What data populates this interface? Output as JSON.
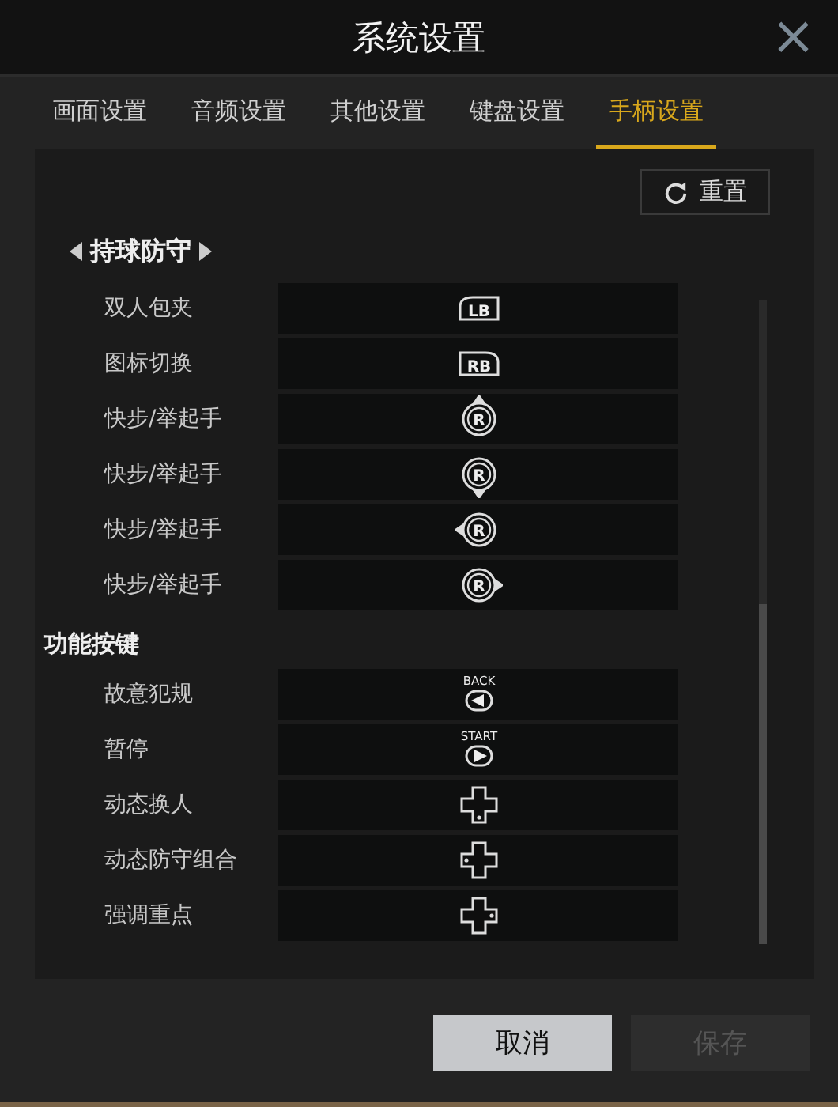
{
  "window": {
    "title": "系统设置",
    "close": "×"
  },
  "tabs": [
    {
      "label": "画面设置",
      "selected": false
    },
    {
      "label": "音频设置",
      "selected": false
    },
    {
      "label": "其他设置",
      "selected": false
    },
    {
      "label": "键盘设置",
      "selected": false
    },
    {
      "label": "手柄设置",
      "selected": true
    }
  ],
  "reset_button": {
    "label": "重置"
  },
  "sections": [
    {
      "title": "持球防守",
      "kind": "switcher",
      "rows": [
        {
          "label": "双人包夹",
          "binding": {
            "kind": "bumper-left",
            "text": "LB"
          }
        },
        {
          "label": "图标切换",
          "binding": {
            "kind": "bumper-right",
            "text": "RB"
          }
        },
        {
          "label": "快步/举起手",
          "binding": {
            "kind": "stick-up",
            "text": "R"
          }
        },
        {
          "label": "快步/举起手",
          "binding": {
            "kind": "stick-down",
            "text": "R"
          }
        },
        {
          "label": "快步/举起手",
          "binding": {
            "kind": "stick-left",
            "text": "R"
          }
        },
        {
          "label": "快步/举起手",
          "binding": {
            "kind": "stick-right",
            "text": "R"
          }
        }
      ]
    },
    {
      "title": "功能按键",
      "kind": "plain",
      "rows": [
        {
          "label": "故意犯规",
          "binding": {
            "kind": "menu-left",
            "text": "BACK"
          }
        },
        {
          "label": "暂停",
          "binding": {
            "kind": "menu-right",
            "text": "START"
          }
        },
        {
          "label": "动态换人",
          "binding": {
            "kind": "dpad-down"
          }
        },
        {
          "label": "动态防守组合",
          "binding": {
            "kind": "dpad-left"
          }
        },
        {
          "label": "强调重点",
          "binding": {
            "kind": "dpad-right"
          }
        }
      ]
    }
  ],
  "buttons": [
    {
      "label": "取消",
      "disabled": false
    },
    {
      "label": "保存",
      "disabled": true
    }
  ]
}
